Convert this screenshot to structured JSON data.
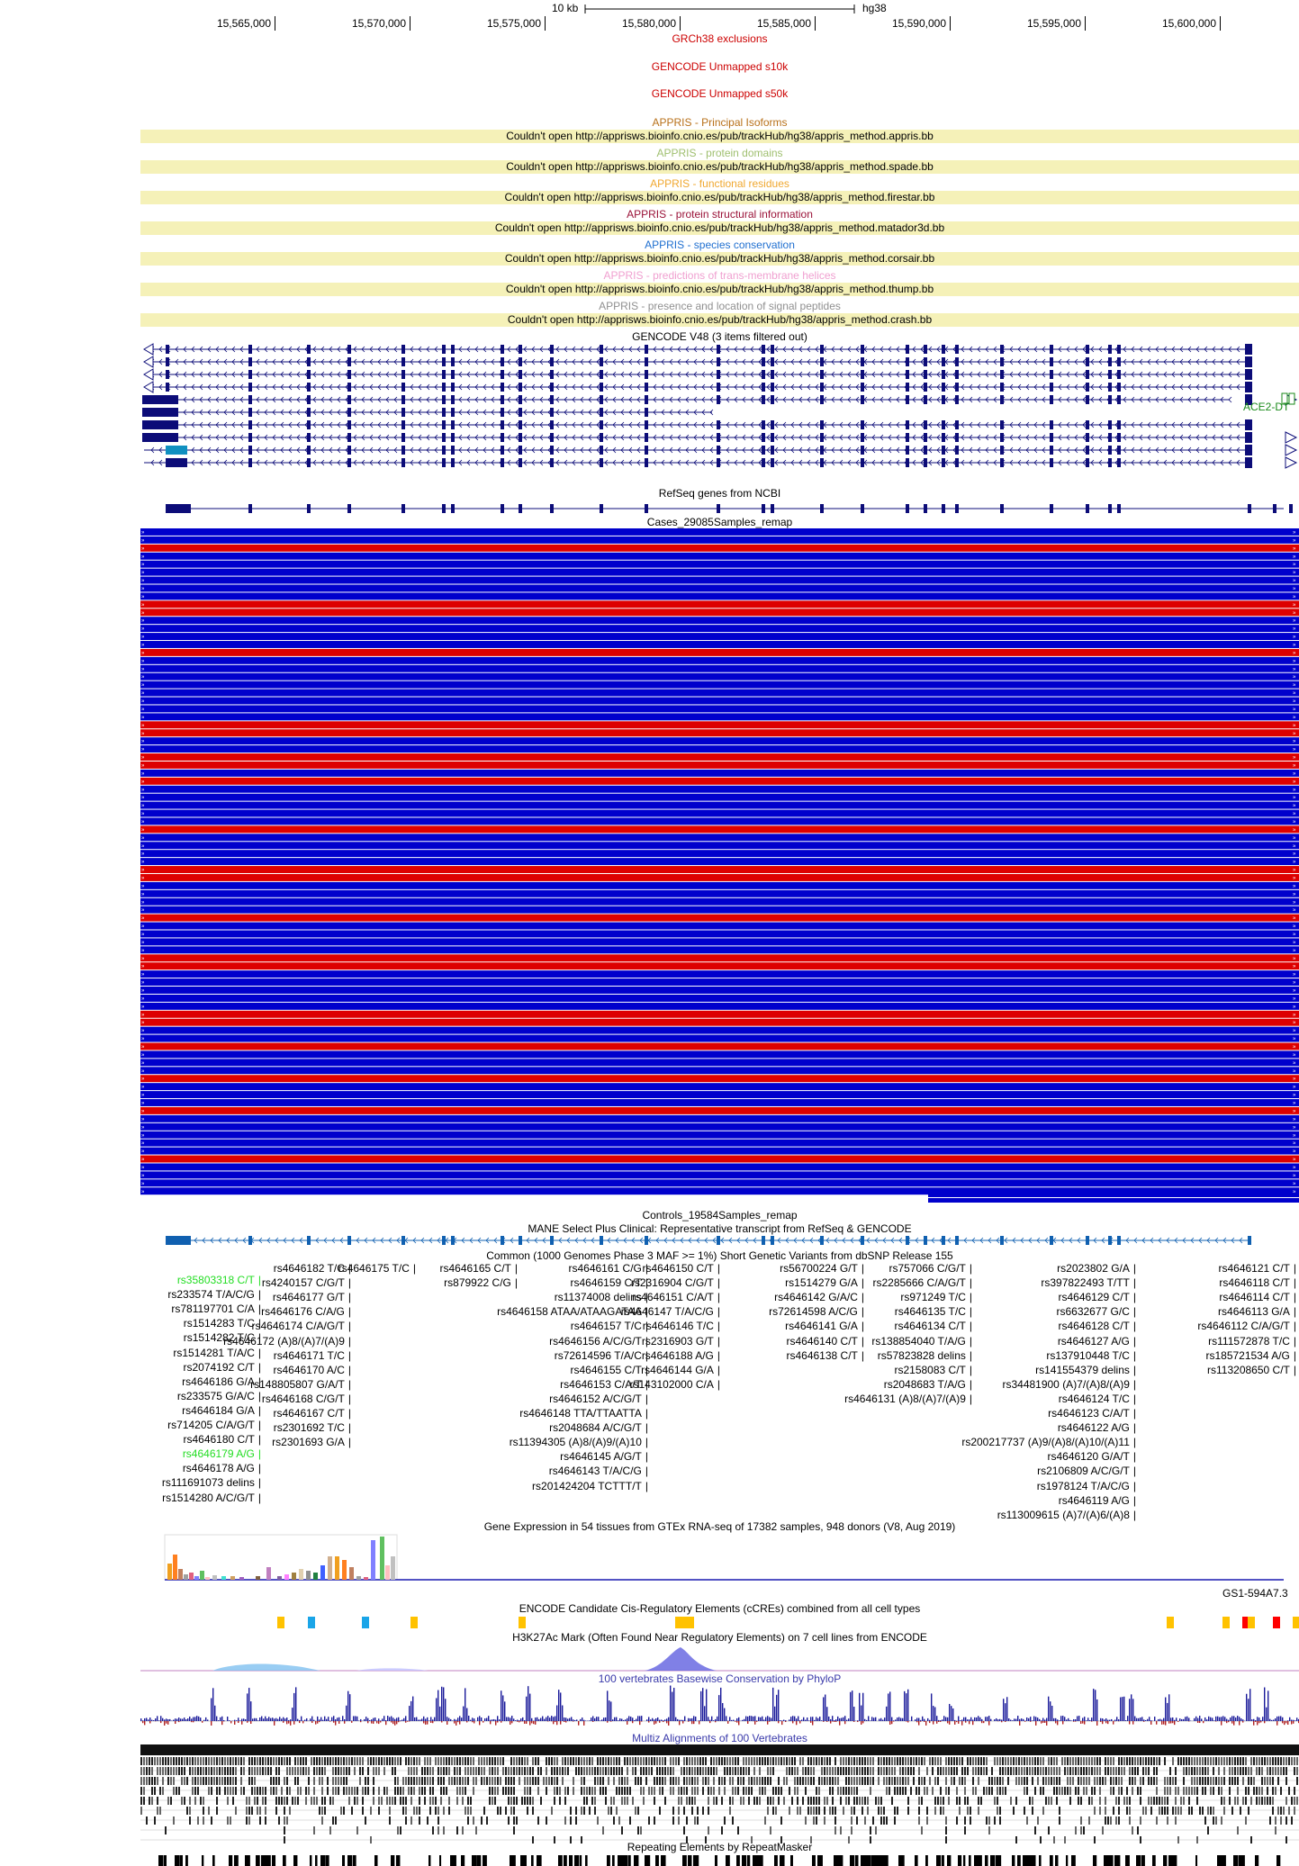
{
  "ruler": {
    "scale_label": "10 kb",
    "assembly": "hg38",
    "ticks": [
      "15,565,000",
      "15,570,000",
      "15,575,000",
      "15,580,000",
      "15,585,000",
      "15,590,000",
      "15,595,000",
      "15,600,000"
    ]
  },
  "tracks": {
    "grch38_exclusions": "GRCh38 exclusions",
    "gencode_unmapped_s10k": "GENCODE Unmapped s10k",
    "gencode_unmapped_s50k": "GENCODE Unmapped s50k",
    "gencode_v48": "GENCODE V48 (3 items filtered out)",
    "ace2_label": "ACE2-DT",
    "refseq": "RefSeq genes from NCBI",
    "cases": "Cases_29085Samples_remap",
    "controls": "Controls_19584Samples_remap",
    "mane": "MANE Select Plus Clinical: Representative transcript from RefSeq & GENCODE",
    "dbsnp": "Common (1000 Genomes Phase 3 MAF >= 1%) Short Genetic Variants from dbSNP Release 155",
    "gtex": "Gene Expression in 54 tissues from GTEx RNA-seq of 17382 samples, 948 donors (V8, Aug 2019)",
    "gtex_gene": "GS1-594A7.3",
    "encode_ccre": "ENCODE Candidate Cis-Regulatory Elements (cCREs) combined from all cell types",
    "h3k27ac": "H3K27Ac Mark (Often Found Near Regulatory Elements) on 7 cell lines from ENCODE",
    "phylop": "100 vertebrates Basewise Conservation by PhyloP",
    "multiz": "Multiz Alignments of 100 Vertebrates",
    "repeatmasker": "Repeating Elements by RepeatMasker"
  },
  "appris": [
    {
      "title": "APPRIS - Principal Isoforms",
      "color": "#b8711a",
      "error": "Couldn't open http://apprisws.bioinfo.cnio.es/pub/trackHub/hg38/appris_method.appris.bb"
    },
    {
      "title": "APPRIS - protein domains",
      "color": "#9fbf6f",
      "error": "Couldn't open http://apprisws.bioinfo.cnio.es/pub/trackHub/hg38/appris_method.spade.bb"
    },
    {
      "title": "APPRIS - functional residues",
      "color": "#f0a830",
      "error": "Couldn't open http://apprisws.bioinfo.cnio.es/pub/trackHub/hg38/appris_method.firestar.bb"
    },
    {
      "title": "APPRIS - protein structural information",
      "color": "#9a1238",
      "error": "Couldn't open http://apprisws.bioinfo.cnio.es/pub/trackHub/hg38/appris_method.matador3d.bb"
    },
    {
      "title": "APPRIS - species conservation",
      "color": "#1f6fd0",
      "error": "Couldn't open http://apprisws.bioinfo.cnio.es/pub/trackHub/hg38/appris_method.corsair.bb"
    },
    {
      "title": "APPRIS - predictions of trans-membrane helices",
      "color": "#f0a0d0",
      "error": "Couldn't open http://apprisws.bioinfo.cnio.es/pub/trackHub/hg38/appris_method.thump.bb"
    },
    {
      "title": "APPRIS - presence and location of signal peptides",
      "color": "#909090",
      "error": "Couldn't open http://apprisws.bioinfo.cnio.es/pub/trackHub/hg38/appris_method.crash.bb"
    }
  ],
  "snps": {
    "col1": [
      "rs35803318 C/T",
      "rs233574 T/A/C/G",
      "rs781197701 C/A",
      "rs1514283 T/C",
      "rs1514282 T/C",
      "rs1514281 T/A/C",
      "rs2074192 C/T",
      "rs4646186 G/A",
      "rs233575 G/A/C",
      "rs4646184 G/A",
      "rs714205 C/A/G/T",
      "rs4646180 C/T",
      "rs4646179 A/G",
      "rs4646178 A/G",
      "rs111691073 delins",
      "rs1514280 A/C/G/T"
    ],
    "col2": [
      "rs4646182 T/C",
      "rs4240157 C/G/T",
      "rs4646177 G/T",
      "rs4646176 C/A/G",
      "rs4646174 C/A/G/T",
      "rs4646172 (A)8/(A)7/(A)9",
      "rs4646171 T/C",
      "rs4646170 A/C",
      "rs148805807 G/A/T",
      "rs4646168 C/G/T",
      "rs4646167 C/T",
      "rs2301692 T/C",
      "rs2301693 G/A"
    ],
    "col2b": [
      "rs4646175 T/C"
    ],
    "col3": [
      "rs4646165 C/T",
      "rs879922 C/G"
    ],
    "col4": [
      "rs4646161 C/G",
      "rs4646159 C/T",
      "rs11374008 delins",
      "rs4646158 ATAA/ATAAGATAA",
      "rs4646157 T/C",
      "rs4646156 A/C/G/T",
      "rs72614596 T/A/C",
      "rs4646155 C/T",
      "rs4646153 C/A/T",
      "rs4646152 A/C/G/T",
      "rs4646148 TTA/TTAATTA",
      "rs2048684 A/C/G/T",
      "rs11394305 (A)8/(A)9/(A)10",
      "rs4646145 A/G/T",
      "rs4646143 T/A/C/G",
      "rs201424204 TCTTT/T"
    ],
    "col5": [
      "rs4646150 C/T",
      "rs2316904 C/G/T",
      "rs4646151 C/A/T",
      "rs4646147 T/A/C/G",
      "rs4646146 T/C",
      "rs2316903 G/T",
      "rs4646188 A/G",
      "rs4646144 G/A",
      "rs143102000 C/A"
    ],
    "col6": [
      "rs56700224 G/T",
      "rs1514279 G/A",
      "rs4646142 G/A/C",
      "rs72614598 A/C/G",
      "rs4646141 G/A",
      "rs4646140 C/T",
      "rs4646138 C/T"
    ],
    "col7": [
      "rs757066 C/G/T",
      "rs2285666 C/A/G/T",
      "rs971249 T/C",
      "rs4646135 T/C",
      "rs4646134 C/T",
      "rs138854040 T/A/G",
      "rs57823828 delins",
      "rs2158083 C/T",
      "rs2048683 T/A/G",
      "rs4646131 (A)8/(A)7/(A)9"
    ],
    "col8": [
      "rs2023802 G/A",
      "rs397822493 T/TT",
      "rs4646129 C/T",
      "rs6632677 G/C",
      "rs4646128 C/T",
      "rs4646127 A/G",
      "rs137910448 T/C",
      "rs141554379 delins",
      "rs34481900 (A)7/(A)8/(A)9",
      "rs4646124 T/C",
      "rs4646123 C/A/T",
      "rs4646122 A/G",
      "rs200217737 (A)9/(A)8/(A)10/(A)11",
      "rs4646120 G/A/T",
      "rs2106809 A/C/G/T",
      "rs1978124 T/A/C/G",
      "rs4646119 A/G",
      "rs113009615 (A)7/(A)6/(A)8"
    ],
    "col9": [
      "rs4646121 C/T",
      "rs4646118 C/T",
      "rs4646114 C/T",
      "rs4646113 G/A",
      "rs4646112 C/A/G/T",
      "rs111572878 T/C",
      "rs185721534 A/G",
      "rs113208650 C/T"
    ],
    "highlight_color": "#22dd22",
    "highlighted": [
      "rs35803318 C/T",
      "rs4646179 A/G"
    ]
  },
  "colors": {
    "gene_blue": "#0c0c78",
    "cases_blue": "#0000cc",
    "cases_red": "#dd0000",
    "mane_blue": "#1060b0",
    "error_bg": "#f5f1b8",
    "title_red": "#cc0000",
    "phylop_blue": "#1a1a9a"
  },
  "cases_pattern": "BBRBBBBBBRRBBBBRBBBBBBBBRRBBRRBRBBBBBRBBBBRRBBBBRBBBBRRBBBBBRRBBRBBBRBBBRBBBBBRBBBB"
}
